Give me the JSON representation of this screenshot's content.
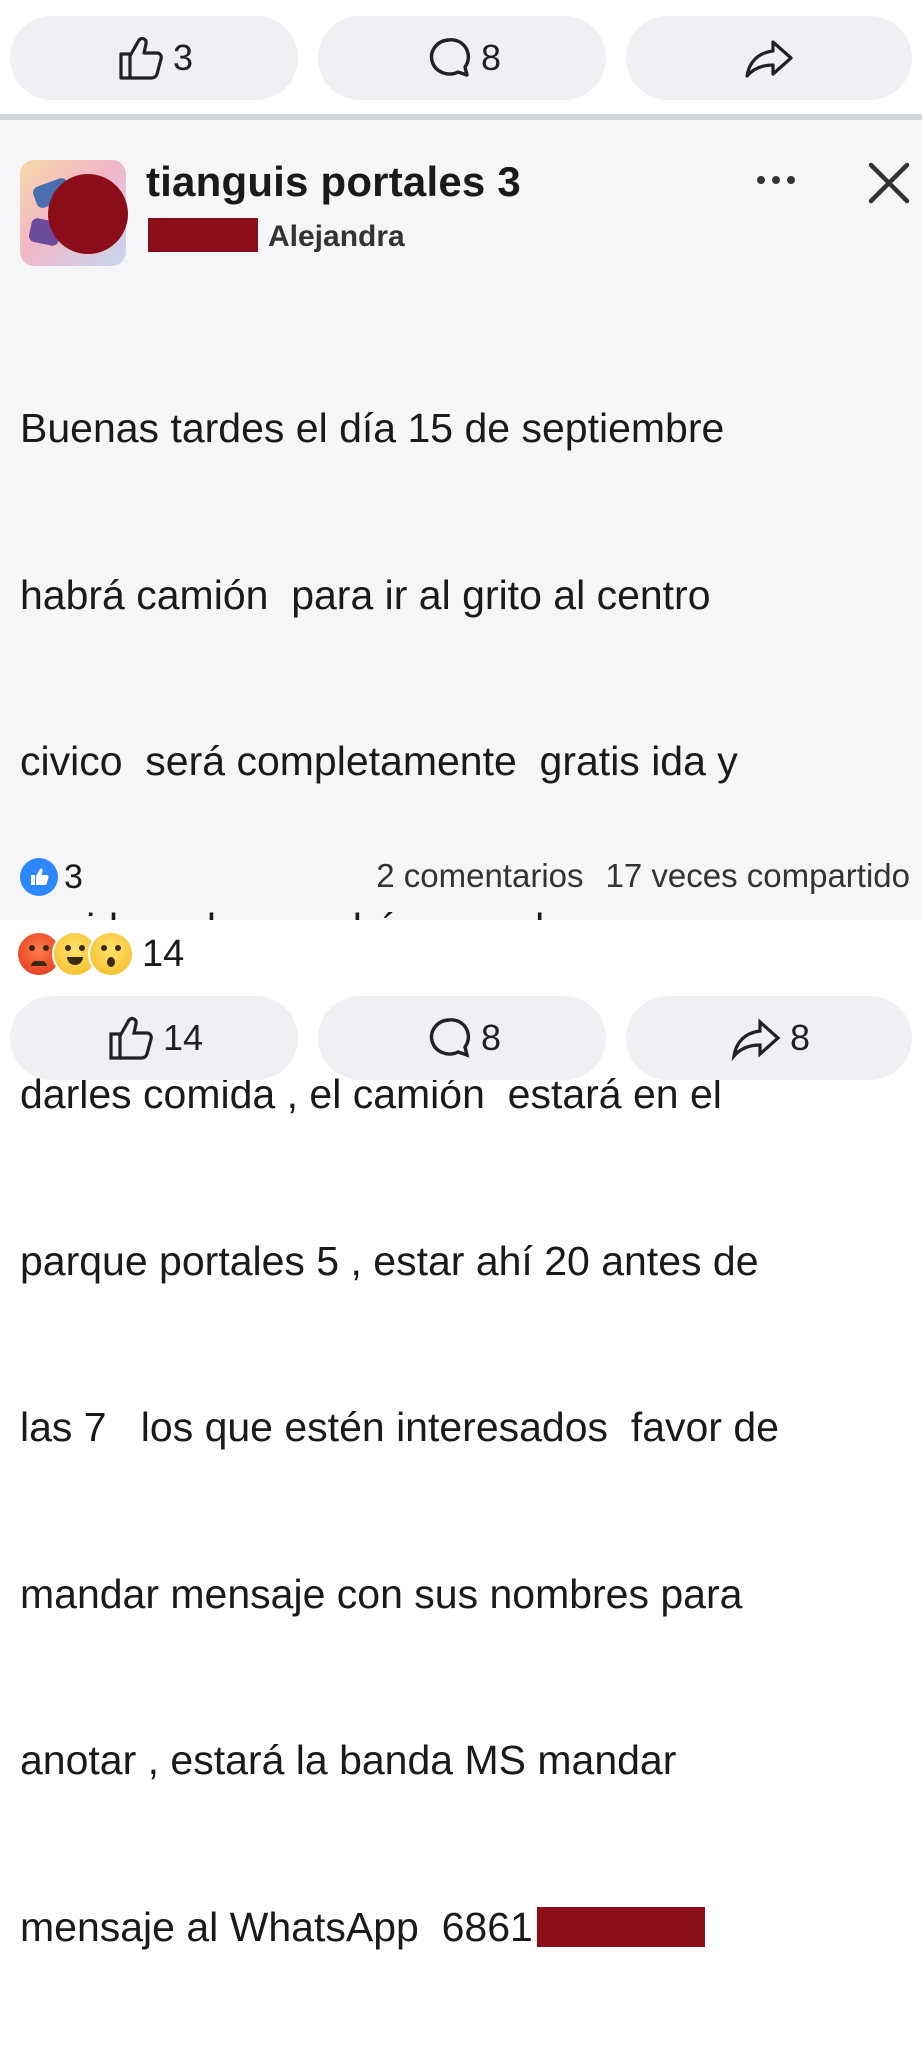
{
  "top_actions": {
    "like_count": "3",
    "comment_count": "8"
  },
  "post": {
    "group_name": "tianguis portales 3",
    "author": "Alejandra",
    "body_lines": [
      "Buenas tardes el día 15 de septiembre",
      "habrá camión  para ir al grito al centro",
      "civico  será completamente  gratis ida y",
      "venida se les pondrá una pulsera para",
      "darles comida , el camión  estará en el",
      "parque portales 5 , estar ahí 20 antes de",
      "las 7   los que estén interesados  favor de",
      "mandar mensaje con sus nombres para",
      "anotar , estará la banda MS mandar",
      "mensaje al WhatsApp  6861"
    ],
    "like_count": "3",
    "comments": "2 comentarios",
    "shares": "17 veces compartido"
  },
  "outer_reactions": {
    "count": "14",
    "types": [
      "angry",
      "haha",
      "wow"
    ]
  },
  "bottom_actions": {
    "like_count": "14",
    "comment_count": "8",
    "share_count": "8"
  },
  "colors": {
    "redaction": "#8b0d1a",
    "pill_bg": "#eef0f3",
    "card_bg": "#f6f6f8",
    "like_blue": "#2d88ff"
  }
}
